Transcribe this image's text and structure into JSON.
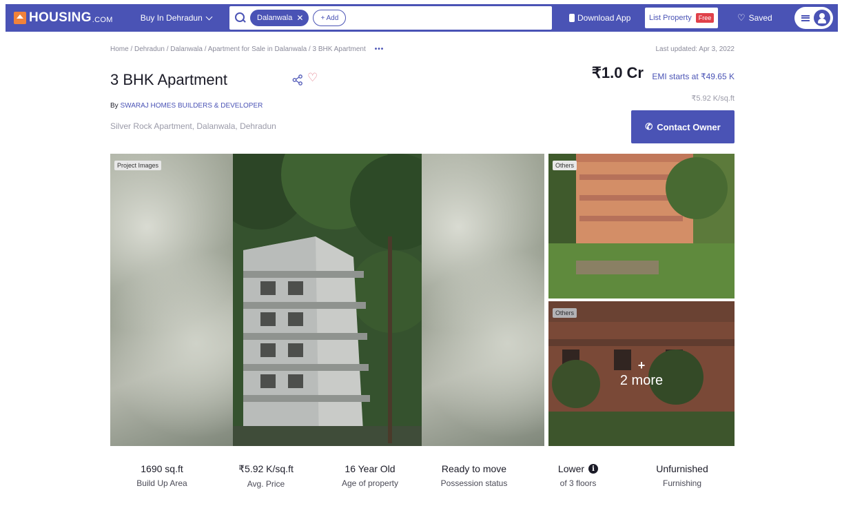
{
  "header": {
    "logo_text": "HOUSING",
    "logo_suffix": ".COM",
    "buy_in": "Buy In Dehradun",
    "search_chip": "Dalanwala",
    "add_label": "+ Add",
    "download_app": "Download App",
    "list_property": "List Property",
    "free_badge": "Free",
    "saved": "Saved"
  },
  "breadcrumb": {
    "text": "Home / Dehradun / Dalanwala / Apartment for Sale in Dalanwala / 3 BHK Apartment",
    "more": "•••",
    "last_updated": "Last updated: Apr 3, 2022"
  },
  "listing": {
    "title": "3 BHK Apartment",
    "builder_prefix": "By",
    "builder_name": "SWARAJ HOMES BUILDERS & DEVELOPER",
    "address": "Silver Rock Apartment, Dalanwala, Dehradun",
    "price": "₹1.0 Cr",
    "emi": "EMI starts at ₹49.65 K",
    "price_per_sqft": "₹5.92 K/sq.ft",
    "contact_button": "Contact Owner"
  },
  "gallery": {
    "project_tag": "Project Images",
    "others_tag_1": "Others",
    "others_tag_2": "Others",
    "more_plus": "+",
    "more_text": "2 more"
  },
  "stats": [
    {
      "value": "1690 sq.ft",
      "label": "Build Up Area"
    },
    {
      "value": "₹5.92 K/sq.ft",
      "label": "Avg. Price"
    },
    {
      "value": "16 Year Old",
      "label": "Age of property"
    },
    {
      "value": "Ready to move",
      "label": "Possession status"
    },
    {
      "value": "Lower",
      "label": "of 3 floors",
      "info_icon": "info-icon"
    },
    {
      "value": "Unfurnished",
      "label": "Furnishing"
    }
  ],
  "colors": {
    "brand": "#4a53b5",
    "badge_red": "#e0414a",
    "logo_orange": "#f1823a"
  }
}
